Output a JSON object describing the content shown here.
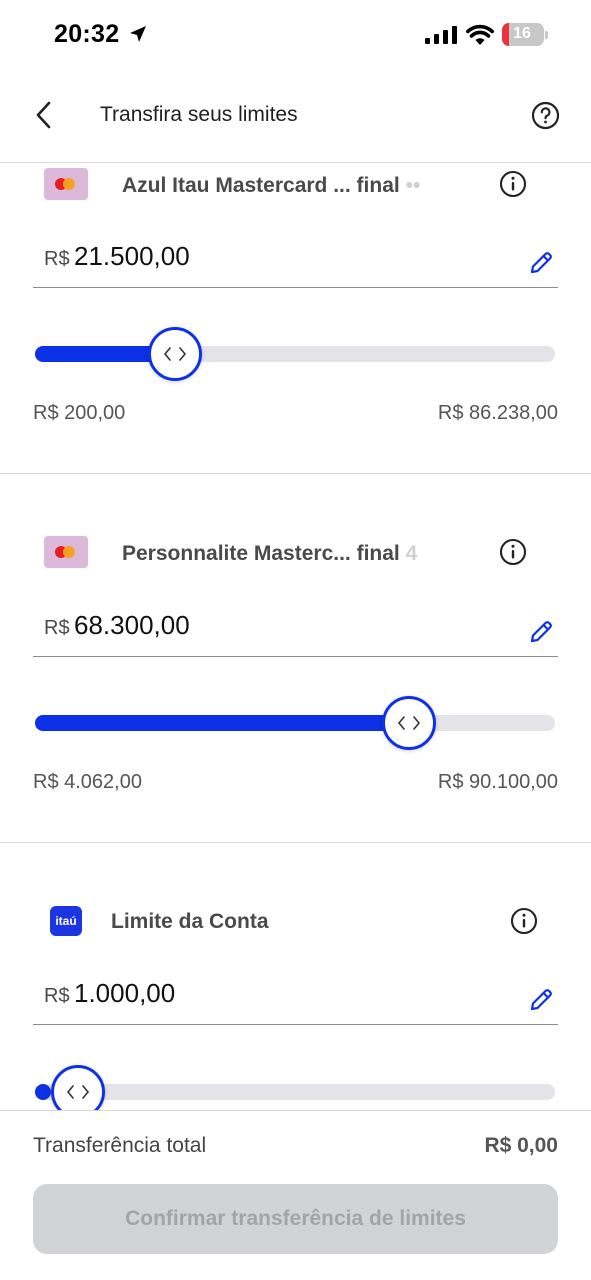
{
  "status_bar": {
    "time": "20:32",
    "battery": "16",
    "icons": [
      "location-arrow-icon",
      "signal-icon",
      "wifi-icon",
      "battery-icon"
    ]
  },
  "header": {
    "title": "Transfira seus limites",
    "back_icon": "chevron-left-icon",
    "help_icon": "question-circle-icon"
  },
  "cards": [
    {
      "name": "Azul Itau Mastercard ... final",
      "name_faded": " ••",
      "logo": "mastercard-logo",
      "currency": "R$",
      "amount": "21.500,00",
      "min": "R$ 200,00",
      "max": "R$ 86.238,00",
      "slider_fraction": 0.27
    },
    {
      "name": "Personnalite Masterc... final",
      "name_faded": " 4",
      "logo": "mastercard-logo",
      "currency": "R$",
      "amount": "68.300,00",
      "min": "R$ 4.062,00",
      "max": "R$ 90.100,00",
      "slider_fraction": 0.72
    },
    {
      "name": "Limite da Conta",
      "name_faded": "",
      "logo": "itau-logo",
      "logo_text": "itaú",
      "currency": "R$",
      "amount": "1.000,00",
      "min": "",
      "max": "",
      "slider_fraction": 0.02
    }
  ],
  "footer": {
    "total_label": "Transferência total",
    "total_value": "R$ 0,00",
    "confirm_label": "Confirmar transferência de limites"
  },
  "colors": {
    "accent": "#0c31e6",
    "disabled_button": "#d2d3d6",
    "card_logo_bg": "#dcb9d8"
  }
}
